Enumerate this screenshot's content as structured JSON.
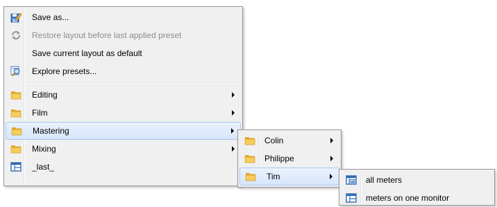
{
  "main_menu": {
    "items": [
      {
        "label": "Save as...",
        "icon": "save-as-icon"
      },
      {
        "label": "Restore layout before last applied preset",
        "icon": "restore-icon"
      },
      {
        "label": "Save current layout as default"
      },
      {
        "label": "Explore presets...",
        "icon": "explore-icon"
      },
      {
        "label": "Editing",
        "icon": "folder-icon"
      },
      {
        "label": "Film",
        "icon": "folder-icon"
      },
      {
        "label": "Mastering",
        "icon": "folder-icon"
      },
      {
        "label": "Mixing",
        "icon": "folder-icon"
      },
      {
        "label": "_last_",
        "icon": "layout-icon"
      }
    ]
  },
  "mastering_submenu": {
    "items": [
      {
        "label": "Colin",
        "icon": "folder-icon"
      },
      {
        "label": "Philippe",
        "icon": "folder-icon"
      },
      {
        "label": "Tim",
        "icon": "folder-icon"
      }
    ]
  },
  "tim_submenu": {
    "items": [
      {
        "label": "all meters",
        "icon": "meters-layout-icon"
      },
      {
        "label": "meters on one monitor",
        "icon": "layout-icon"
      }
    ]
  },
  "colors": {
    "menu_bg": "#f0f0f0",
    "highlight_border": "#a8c8ee",
    "folder": "#f5c64e",
    "layout_icon": "#2f6bb0"
  }
}
